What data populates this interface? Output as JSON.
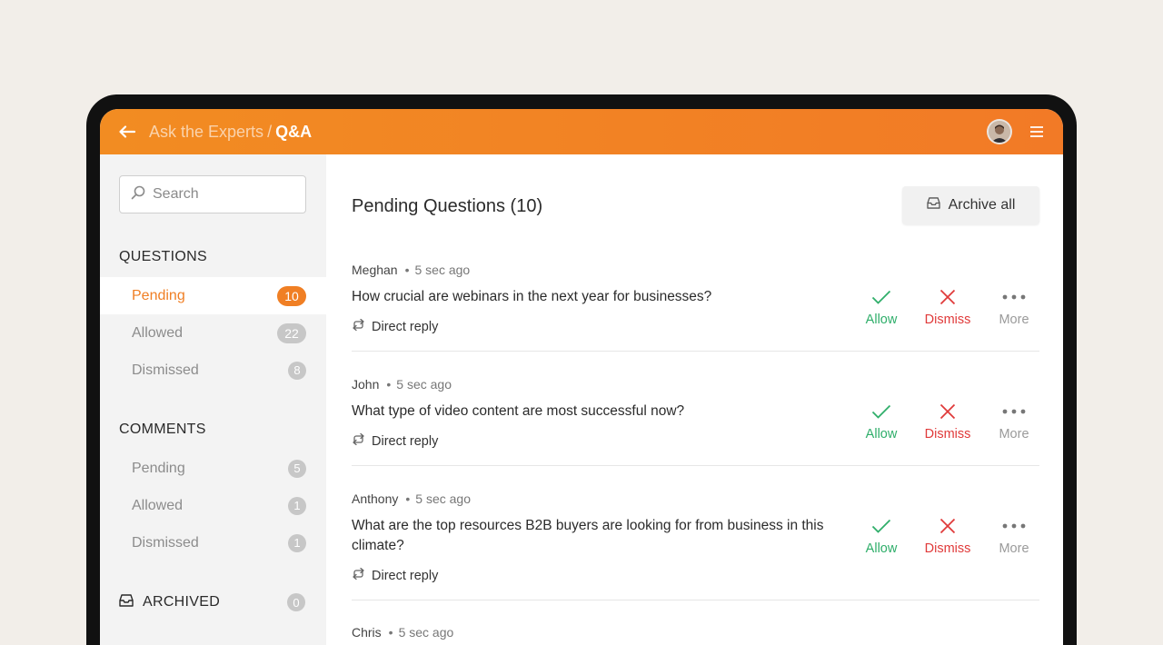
{
  "header": {
    "breadcrumb_parent": "Ask the Experts",
    "breadcrumb_separator": "/",
    "breadcrumb_current": "Q&A"
  },
  "sidebar": {
    "search_placeholder": "Search",
    "questions_title": "QUESTIONS",
    "questions": [
      {
        "label": "Pending",
        "count": "10",
        "active": true
      },
      {
        "label": "Allowed",
        "count": "22",
        "active": false
      },
      {
        "label": "Dismissed",
        "count": "8",
        "active": false
      }
    ],
    "comments_title": "COMMENTS",
    "comments": [
      {
        "label": "Pending",
        "count": "5"
      },
      {
        "label": "Allowed",
        "count": "1"
      },
      {
        "label": "Dismissed",
        "count": "1"
      }
    ],
    "archived_label": "ARCHIVED",
    "archived_count": "0"
  },
  "main": {
    "title": "Pending Questions (10)",
    "archive_all_label": "Archive all",
    "actions": {
      "allow": "Allow",
      "dismiss": "Dismiss",
      "more": "More",
      "reply": "Direct reply"
    },
    "questions": [
      {
        "author": "Meghan",
        "time": "5 sec ago",
        "text": "How crucial are webinars in the next year for businesses?"
      },
      {
        "author": "John",
        "time": "5 sec ago",
        "text": "What type of video content are most successful now?"
      },
      {
        "author": "Anthony",
        "time": "5 sec ago",
        "text": "What are the top resources B2B buyers are looking for from business in this climate?"
      },
      {
        "author": "Chris",
        "time": "5 sec ago",
        "text": ""
      }
    ]
  },
  "colors": {
    "brand_orange": "#f28c22",
    "allow_green": "#2fae6a",
    "dismiss_red": "#e03a3a"
  },
  "icons": [
    "back-arrow-icon",
    "avatar",
    "hamburger-menu-icon",
    "search-icon",
    "archive-tray-icon",
    "check-icon",
    "x-icon",
    "more-dots-icon",
    "reply-icon"
  ]
}
